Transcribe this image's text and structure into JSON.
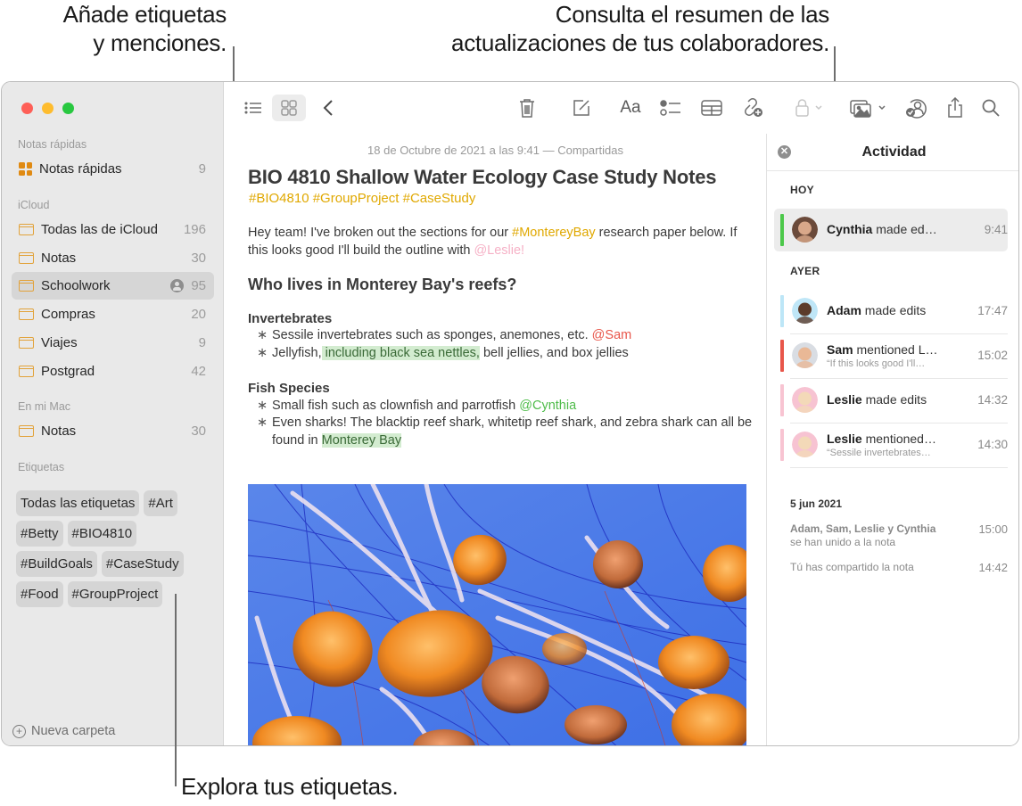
{
  "callouts": {
    "tags_mentions": [
      "Añade etiquetas",
      "y menciones."
    ],
    "activity_summary": [
      "Consulta el resumen de las",
      "actualizaciones de tus colaboradores."
    ],
    "explore_tags": "Explora tus etiquetas."
  },
  "sidebar": {
    "sections": {
      "quick_notes": "Notas rápidas",
      "icloud": "iCloud",
      "on_my_mac": "En mi Mac",
      "tags": "Etiquetas"
    },
    "quick_notes_item": {
      "label": "Notas rápidas",
      "count": "9",
      "icon": "quick-notes-icon"
    },
    "icloud_folders": [
      {
        "label": "Todas las de iCloud",
        "count": "196",
        "icon": "folder-icon"
      },
      {
        "label": "Notas",
        "count": "30",
        "icon": "folder-icon"
      },
      {
        "label": "Schoolwork",
        "count": "95",
        "icon": "folder-icon",
        "shared": true,
        "selected": true
      },
      {
        "label": "Compras",
        "count": "20",
        "icon": "folder-icon"
      },
      {
        "label": "Viajes",
        "count": "9",
        "icon": "folder-icon"
      },
      {
        "label": "Postgrad",
        "count": "42",
        "icon": "folder-icon"
      }
    ],
    "mac_folders": [
      {
        "label": "Notas",
        "count": "30",
        "icon": "folder-icon"
      }
    ],
    "tags": [
      "Todas las etiquetas",
      "#Art",
      "#Betty",
      "#BIO4810",
      "#BuildGoals",
      "#CaseStudy",
      "#Food",
      "#GroupProject"
    ],
    "new_folder_label": "Nueva carpeta"
  },
  "toolbar": {
    "left": [
      "list-view-icon",
      "gallery-view-icon",
      "back-chevron-icon"
    ],
    "right": [
      "delete-icon",
      "compose-icon",
      "format-text-icon",
      "checklist-icon",
      "table-icon",
      "collaborate-link-icon",
      "lock-icon",
      "media-icon",
      "activity-icon",
      "share-icon",
      "search-icon"
    ],
    "format_label": "Aa"
  },
  "note": {
    "date": "18 de Octubre de 2021 a las 9:41 — Compartidas",
    "title": "BIO 4810 Shallow Water Ecology Case Study Notes",
    "tags_line": "#BIO4810 #GroupProject #CaseStudy",
    "intro": {
      "part1": "Hey team! I've broken out the sections for our ",
      "tag": "#MontereyBay",
      "part2": " research paper below. If this looks good I'll build the outline with ",
      "mention": "@Leslie!"
    },
    "heading": "Who lives in Monterey Bay's reefs?",
    "sections": [
      {
        "title": "Invertebrates",
        "bullets": [
          {
            "text": "Sessile invertebrates such as sponges, anemones, etc. ",
            "mention": "@Sam"
          },
          {
            "pre": "Jellyfish,",
            "highlight": " including black sea nettles,",
            "post": " bell jellies, and box jellies"
          }
        ]
      },
      {
        "title": "Fish Species",
        "bullets": [
          {
            "text": "Small fish such as clownfish and parrotfish ",
            "mention": "@Cynthia"
          },
          {
            "pre": "Even sharks! The blacktip reef shark, whitetip reef shark, and zebra shark can all be found in ",
            "highlight": "Monterey Bay",
            "post": ""
          }
        ]
      }
    ],
    "bullet_char": "∗",
    "image_alt": "Jellyfish photo"
  },
  "activity": {
    "title": "Actividad",
    "today_label": "HOY",
    "yesterday_label": "AYER",
    "today": [
      {
        "name": "Cynthia",
        "action": " made ed…",
        "time": "9:41",
        "color": "#4cc84a",
        "selected": true
      }
    ],
    "yesterday": [
      {
        "name": "Adam",
        "action": " made edits",
        "time": "17:47",
        "color": "#bde6f7"
      },
      {
        "name": "Sam",
        "action": " mentioned L…",
        "sub": "“If this looks good I'll…",
        "time": "15:02",
        "color": "#e8564a"
      },
      {
        "name": "Leslie",
        "action": " made edits",
        "time": "14:32",
        "color": "#f8c4d2"
      },
      {
        "name": "Leslie",
        "action": " mentioned…",
        "sub": "“Sessile invertebrates…",
        "time": "14:30",
        "color": "#f8c4d2"
      }
    ],
    "history_date": "5 jun 2021",
    "history": [
      {
        "bold": "Adam, Sam, Leslie y Cynthia",
        "text": "se han unido a la nota",
        "time": "15:00"
      },
      {
        "bold": "",
        "text": "Tú has compartido la nota",
        "time": "14:42"
      }
    ]
  }
}
